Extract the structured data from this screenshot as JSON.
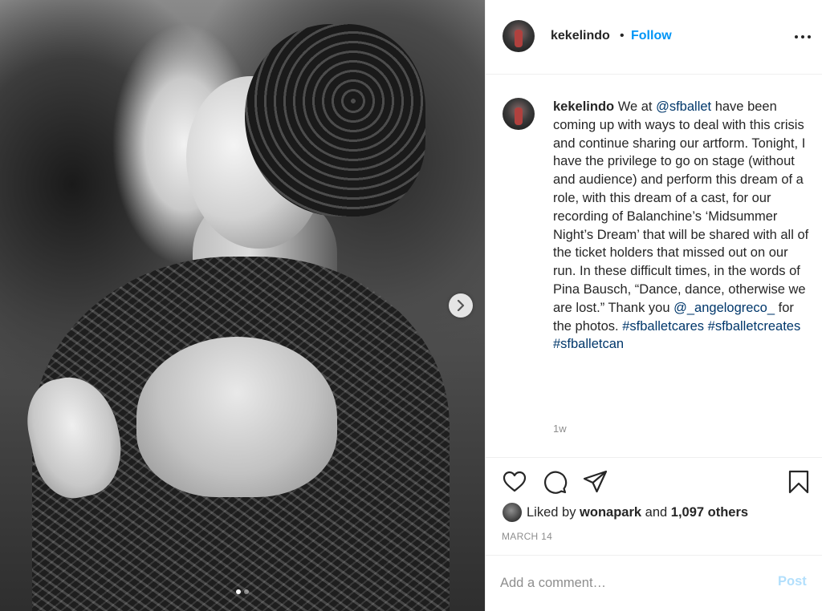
{
  "photo": {
    "alt": "",
    "carousel_dots": 2,
    "active_dot": 1
  },
  "header": {
    "username": "kekelindo",
    "separator": "•",
    "follow_label": "Follow"
  },
  "caption": {
    "username": "kekelindo",
    "t1": " We at ",
    "mention1": "@sfballet",
    "t2": " have been coming up with ways to deal with this crisis and continue sharing our artform. Tonight, I have the privilege to go on stage (without and audience) and perform this dream of a role, with this dream of a cast, for our recording of Balanchine’s ‘Midsummer Night’s Dream’ that will be shared with all of the ticket holders that missed out on our run. In these difficult times, in the words of Pina Bausch, “Dance, dance, otherwise we are lost.” Thank you ",
    "mention2": "@_angelogreco_",
    "t3": " for the photos. ",
    "hashtag1": "#sfballetcares",
    "hashtag2": "#sfballetcreates",
    "hashtag3": "#sfballetcan",
    "time": "1w"
  },
  "likes": {
    "prefix": "Liked by ",
    "user": "wonapark",
    "middle": " and ",
    "count": "1,097 others"
  },
  "date": "MARCH 14",
  "comment": {
    "placeholder": "Add a comment…",
    "post_label": "Post"
  },
  "colors": {
    "link": "#0095f6",
    "tag": "#00376b",
    "muted": "#8e8e8e",
    "post_disabled": "#b2dffc"
  }
}
